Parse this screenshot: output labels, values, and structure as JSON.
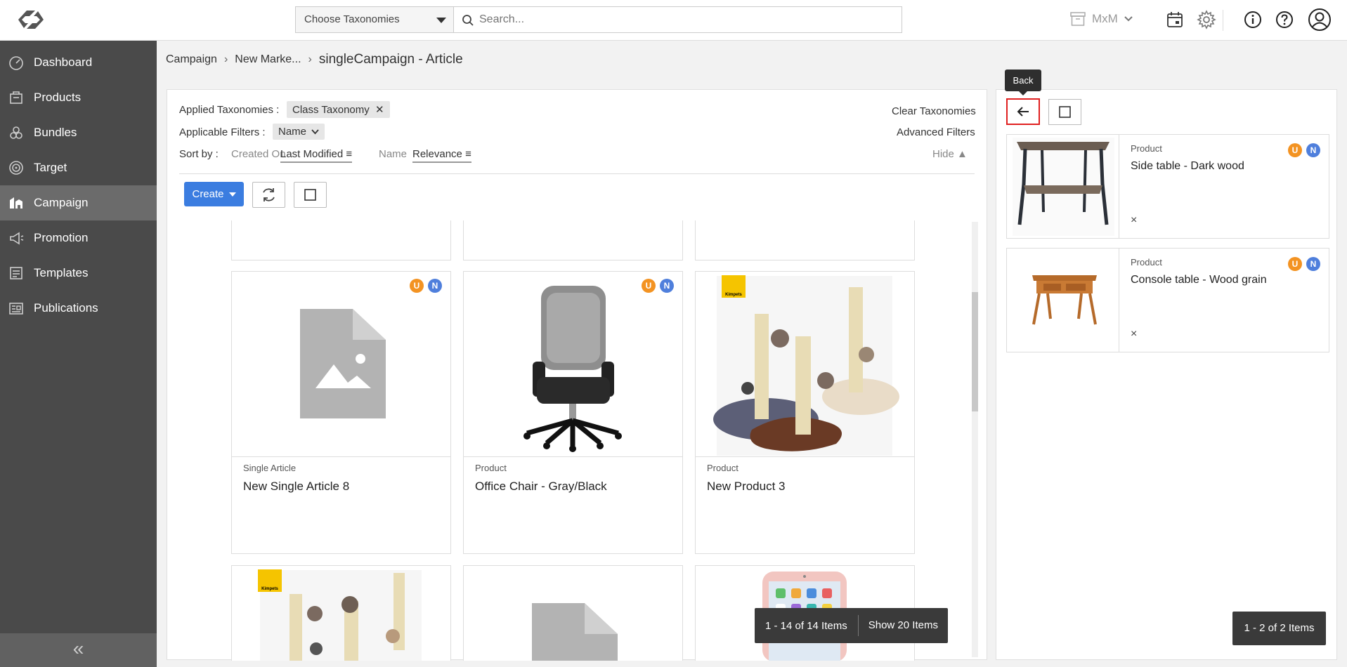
{
  "header": {
    "taxonomy_select": "Choose Taxonomies",
    "search_placeholder": "Search...",
    "org_name": "MxM"
  },
  "sidebar": {
    "items": [
      {
        "label": "Dashboard"
      },
      {
        "label": "Products"
      },
      {
        "label": "Bundles"
      },
      {
        "label": "Target"
      },
      {
        "label": "Campaign"
      },
      {
        "label": "Promotion"
      },
      {
        "label": "Templates"
      },
      {
        "label": "Publications"
      }
    ],
    "collapse_glyph": "«"
  },
  "breadcrumb": {
    "items": [
      "Campaign",
      "New Marke...",
      "singleCampaign - Article"
    ],
    "separator": "›"
  },
  "filters": {
    "applied_label": "Applied Taxonomies :",
    "applied_chip": "Class Taxonomy",
    "clear_label": "Clear Taxonomies",
    "applicable_label": "Applicable Filters :",
    "applicable_select": "Name",
    "advanced_label": "Advanced Filters",
    "sort_label": "Sort by :",
    "sort_created": "Created On",
    "sort_last_modified": "Last Modified",
    "sort_name": "Name",
    "sort_relevance": "Relevance",
    "hide_label": "Hide ▲"
  },
  "toolbar": {
    "create_label": "Create"
  },
  "cards": [
    {
      "type": "Single Article",
      "title": "New Single Article 8",
      "badge_u": "U",
      "badge_n": "N"
    },
    {
      "type": "Product",
      "title": "Office Chair - Gray/Black",
      "badge_u": "U",
      "badge_n": "N"
    },
    {
      "type": "Product",
      "title": "New Product 3",
      "brand": "Kimpets"
    }
  ],
  "bottom_row": [
    {
      "brand": "Kimpets"
    }
  ],
  "pager": {
    "range": "1 - 14 of 14 Items",
    "show": "Show 20 Items"
  },
  "right_panel": {
    "tooltip": "Back",
    "items": [
      {
        "type": "Product",
        "title": "Side table - Dark wood",
        "badge_u": "U",
        "badge_n": "N",
        "remove": "×"
      },
      {
        "type": "Product",
        "title": "Console table - Wood grain",
        "badge_u": "U",
        "badge_n": "N",
        "remove": "×"
      }
    ],
    "pager": "1 - 2 of 2 Items"
  },
  "colors": {
    "sidebar_bg": "#4a4a4a",
    "sidebar_active": "#6b6b6b",
    "primary": "#3b7de0",
    "badge_u": "#f39322",
    "badge_n": "#4f7fdc",
    "back_highlight": "#e02020"
  }
}
